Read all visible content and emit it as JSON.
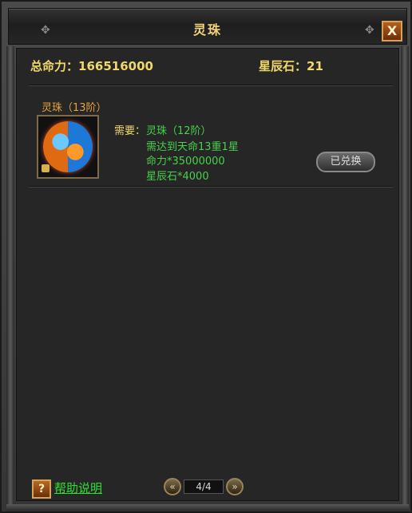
{
  "window": {
    "title": "灵珠",
    "close_label": "X"
  },
  "stats": {
    "total_fate_label": "总命力：",
    "total_fate_value": "166516000",
    "star_stone_label": "星辰石：",
    "star_stone_value": "21"
  },
  "item": {
    "name": "灵珠（13阶）",
    "icon": "spirit-orb-icon",
    "requirement_label": "需要：",
    "requirements": [
      "灵珠（12阶）",
      "需达到天命13重1星",
      "命力*35000000",
      "星辰石*4000"
    ],
    "redeem_button_label": "已兑换"
  },
  "footer": {
    "help_icon_label": "?",
    "help_link": "帮助说明",
    "pager": {
      "prev_label": "«",
      "next_label": "»",
      "text": "4/4"
    }
  },
  "colors": {
    "title": "#f2d37a",
    "stat": "#f0d86a",
    "item_name": "#e8a23a",
    "requirement_value": "#46d24a",
    "help_link": "#30e030"
  }
}
